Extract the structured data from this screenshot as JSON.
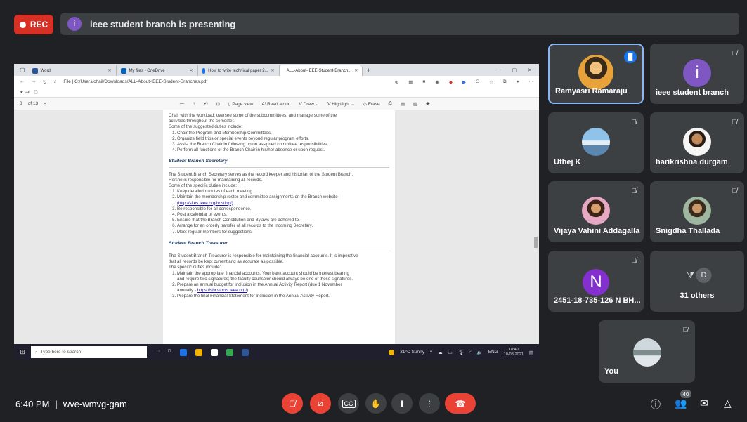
{
  "rec_label": "REC",
  "presenting": {
    "avatar_letter": "i",
    "text": "ieee student branch is presenting"
  },
  "browser": {
    "tabs": [
      {
        "label": "Word",
        "color": "#2b579a"
      },
      {
        "label": "My files - OneDrive",
        "color": "#0364b8"
      },
      {
        "label": "How to write technical paper 2...",
        "color": "#1a73e8"
      },
      {
        "label": "ALL-About-IEEE-Student-Branch...",
        "color": "#d93025"
      }
    ],
    "new_tab": "+",
    "url": "File | C:/Users/chail/Downloads/ALL-About-IEEE-Student-Branches.pdf",
    "fav_item": "sai",
    "pdf_toolbar": {
      "page_input": "8",
      "page_total": "of 13",
      "page_view": "Page view",
      "read_aloud": "Read aloud",
      "draw": "Draw",
      "highlight": "Highlight",
      "erase": "Erase"
    }
  },
  "doc": {
    "intro_lines": [
      "Chair with the workload, oversee some of the subcommittees, and manage some of the",
      "activities throughout the semester.",
      "Some of the suggested duties include:"
    ],
    "intro_list": [
      "Chair the Program and Membership Committees.",
      "Organize field trips or special events beyond regular program efforts.",
      "Assist the Branch Chair in following up on assigned committee responsibilities.",
      "Perform all functions of the Branch Chair in his/her absence or upon request."
    ],
    "secretary_heading": "Student Branch Secretary",
    "secretary_lines": [
      "The Student Branch Secretary serves as the record keeper and historian of the Student Branch.",
      "He/she is responsible for maintaining all records.",
      "Some of the specific duties include:"
    ],
    "secretary_list": [
      "Keep detailed minutes of each meeting.",
      "Maintain the membership roster and committee assignments on the Branch website",
      "Be responsible for all correspondence.",
      "Post a calendar of events.",
      "Ensure that the Branch Constitution and Bylaws are adhered to.",
      "Arrange for an orderly transfer of all records to the incoming Secretary.",
      "Meet regular members for suggestions."
    ],
    "secretary_link": "(http://sites.ieee.org/hosting/)",
    "treasurer_heading": "Student Branch Treasurer",
    "treasurer_lines": [
      "The Student Branch Treasurer is responsible for maintaining the financial accounts. It is imperative",
      "that all records be kept current and as accurate as possible.",
      "The specific duties include:"
    ],
    "treasurer_item1a": "Maintain the appropriate financial accounts. Your bank account should be interest bearing",
    "treasurer_item1b": "and require two signatures; the faculty counselor should always be one of those signatures.",
    "treasurer_item2a": "Prepare an annual budget for inclusion in the Annual Activity Report (due 1 November",
    "treasurer_item2b_prefix": "annually - ",
    "treasurer_item2b_link": "https://sbr.vtools.ieee.org/",
    "treasurer_item3": "Prepare the final Financial Statement for inclusion in the Annual Activity Report."
  },
  "taskbar": {
    "search_placeholder": "Type here to search",
    "weather": "31°C Sunny",
    "lang": "ENG",
    "time": "18:40",
    "date": "10-08-2021"
  },
  "participants": [
    {
      "name": "Ramyasri Ramaraju"
    },
    {
      "name": "ieee student branch",
      "letter": "i",
      "color": "#7e57c2"
    },
    {
      "name": "Uthej K"
    },
    {
      "name": "harikrishna durgam"
    },
    {
      "name": "Vijaya Vahini Addagalla"
    },
    {
      "name": "Snigdha Thallada"
    },
    {
      "name": "2451-18-735-126 N BH...",
      "letter": "N",
      "color": "#8430ce"
    },
    {
      "name": "31 others",
      "letter": "D"
    },
    {
      "name": "You"
    }
  ],
  "meeting": {
    "time": "6:40 PM",
    "separator": "|",
    "code": "wve-wmvg-gam"
  },
  "people_count": "40",
  "colors": {
    "background": "#202124",
    "tile": "#3c4043",
    "danger": "#ea4335",
    "active_border": "#8ab4f8"
  }
}
